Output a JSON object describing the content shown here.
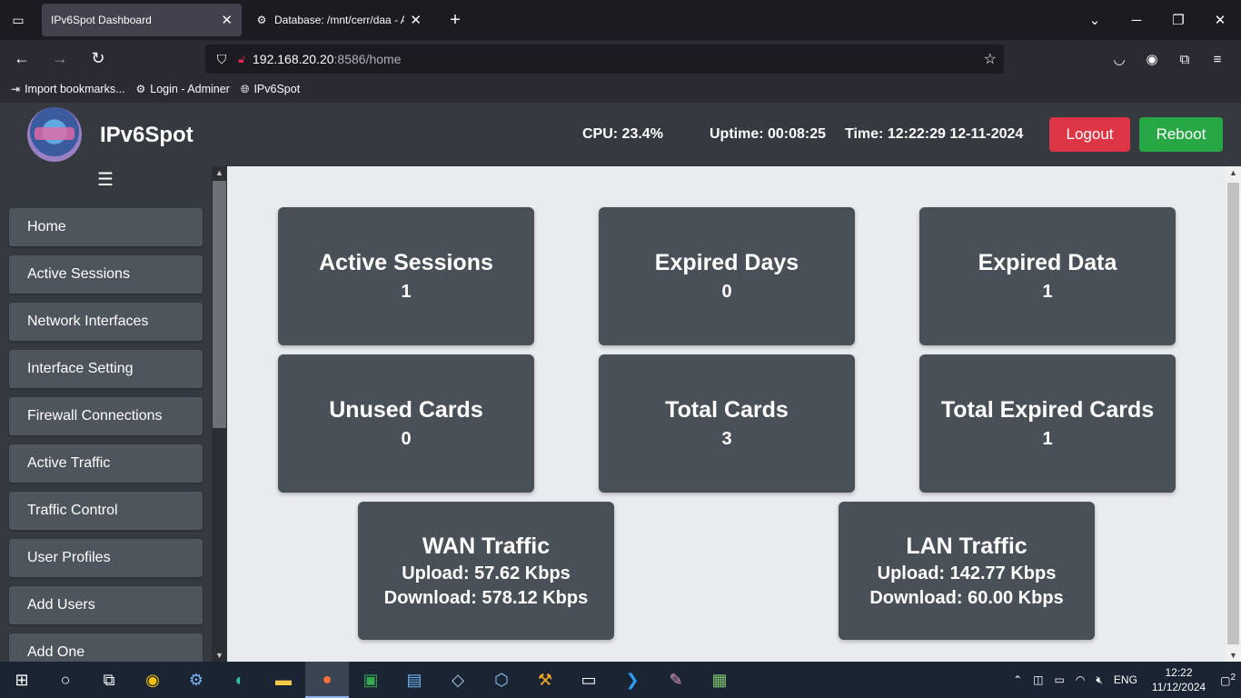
{
  "browser": {
    "tabs": [
      {
        "title": "IPv6Spot Dashboard",
        "active": true
      },
      {
        "title": "Database: /mnt/cerr/daa - Adm",
        "active": false
      }
    ],
    "url_host": "192.168.20.20",
    "url_path": ":8586/home",
    "bookmarks": [
      "Import bookmarks...",
      "Login - Adminer",
      "IPv6Spot"
    ]
  },
  "header": {
    "brand": "IPv6Spot",
    "cpu": "CPU: 23.4%",
    "uptime": "Uptime: 00:08:25",
    "time": "Time: 12:22:29 12-11-2024",
    "logout": "Logout",
    "reboot": "Reboot"
  },
  "sidebar": {
    "items": [
      {
        "label": "Home"
      },
      {
        "label": "Active Sessions"
      },
      {
        "label": "Network Interfaces"
      },
      {
        "label": "Interface Setting"
      },
      {
        "label": "Firewall Connections"
      },
      {
        "label": "Active Traffic"
      },
      {
        "label": "Traffic Control"
      },
      {
        "label": "User Profiles"
      },
      {
        "label": "Add Users"
      },
      {
        "label": "Add One"
      }
    ]
  },
  "cards": {
    "active_sessions": {
      "title": "Active Sessions",
      "value": "1"
    },
    "expired_days": {
      "title": "Expired Days",
      "value": "0"
    },
    "expired_data": {
      "title": "Expired Data",
      "value": "1"
    },
    "unused_cards": {
      "title": "Unused Cards",
      "value": "0"
    },
    "total_cards": {
      "title": "Total Cards",
      "value": "3"
    },
    "total_expired": {
      "title": "Total Expired Cards",
      "value": "1"
    },
    "wan": {
      "title": "WAN Traffic",
      "upload": "Upload: 57.62 Kbps",
      "download": "Download: 578.12 Kbps"
    },
    "lan": {
      "title": "LAN Traffic",
      "upload": "Upload: 142.77 Kbps",
      "download": "Download: 60.00 Kbps"
    }
  },
  "taskbar": {
    "lang": "ENG",
    "time": "12:22",
    "date": "11/12/2024",
    "notifications": "2"
  }
}
